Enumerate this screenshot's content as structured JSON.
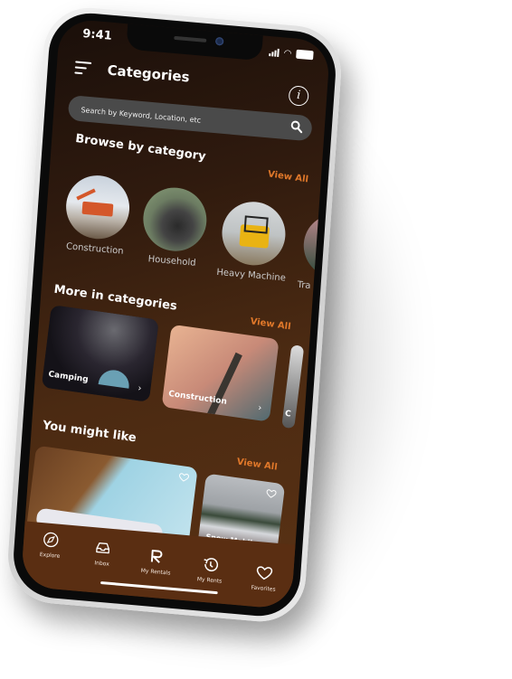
{
  "status_bar": {
    "time": "9:41"
  },
  "header": {
    "title": "Categories",
    "menu_icon": "menu-icon",
    "info_icon": "info-icon"
  },
  "search": {
    "placeholder": "Search by Keyword, Location, etc",
    "value": "",
    "icon": "search-icon"
  },
  "browse": {
    "title": "Browse by category",
    "view_all": "View All",
    "items": [
      {
        "label": "Construction",
        "image": "excavator"
      },
      {
        "label": "Household",
        "image": "tractor-wheel"
      },
      {
        "label": "Heavy Machine",
        "image": "skid-steer-loader"
      },
      {
        "label": "Tra",
        "image": "partial"
      }
    ]
  },
  "more": {
    "title": "More in categories",
    "view_all": "View All",
    "items": [
      {
        "label": "Camping",
        "image": "tent-under-milky-way"
      },
      {
        "label": "Construction",
        "image": "crane-tower"
      },
      {
        "label": "C",
        "image": "partial"
      }
    ]
  },
  "like": {
    "title": "You might like",
    "view_all": "View All",
    "items": [
      {
        "label": "",
        "image": "jet-ski-dock"
      },
      {
        "label": "Snow Mobile",
        "image": "snowmobiles-field"
      }
    ]
  },
  "tabbar": {
    "items": [
      {
        "label": "Explore",
        "icon": "compass-icon"
      },
      {
        "label": "Inbox",
        "icon": "inbox-icon"
      },
      {
        "label": "My Rentals",
        "icon": "r-logo-icon"
      },
      {
        "label": "My Rents",
        "icon": "history-icon"
      },
      {
        "label": "Favorites",
        "icon": "heart-icon"
      }
    ]
  },
  "colors": {
    "accent": "#e0782a",
    "background": "#4b2a12",
    "tabbar": "#5a2e12",
    "search_bg": "#4a4a4a"
  }
}
